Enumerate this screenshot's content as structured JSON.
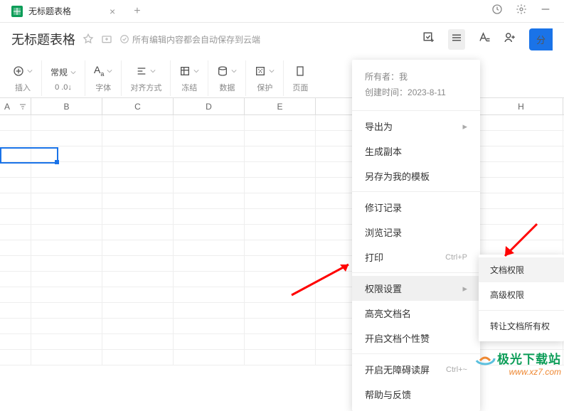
{
  "tab": {
    "title": "无标题表格"
  },
  "doc": {
    "title": "无标题表格",
    "save_status": "所有编辑内容都会自动保存到云端"
  },
  "toolbar": {
    "insert": {
      "label": "插入"
    },
    "format": {
      "value": "常规",
      "sub": "0 .0↓",
      "label": ""
    },
    "font": {
      "label": "字体"
    },
    "align": {
      "label": "对齐方式"
    },
    "freeze": {
      "label": "冻结"
    },
    "data": {
      "label": "数据"
    },
    "protect": {
      "label": "保护"
    },
    "page": {
      "label": "页面"
    }
  },
  "share_label": "分",
  "columns": [
    "A",
    "B",
    "C",
    "D",
    "E",
    "H"
  ],
  "menu": {
    "owner_label": "所有者：",
    "owner_value": "我",
    "created_label": "创建时间：",
    "created_value": "2023-8-11",
    "export": "导出为",
    "duplicate": "生成副本",
    "save_template": "另存为我的模板",
    "revisions": "修订记录",
    "history": "浏览记录",
    "print": "打印",
    "print_shortcut": "Ctrl+P",
    "permissions": "权限设置",
    "highlight_name": "高亮文档名",
    "doc_like": "开启文档个性赞",
    "screen_reader": "开启无障碍读屏",
    "screen_reader_shortcut": "Ctrl+~",
    "help": "帮助与反馈"
  },
  "submenu": {
    "doc_perm": "文档权限",
    "adv_perm": "高级权限",
    "transfer": "转让文档所有权"
  },
  "watermark": {
    "text": "极光下载站",
    "url": "www.xz7.com"
  }
}
